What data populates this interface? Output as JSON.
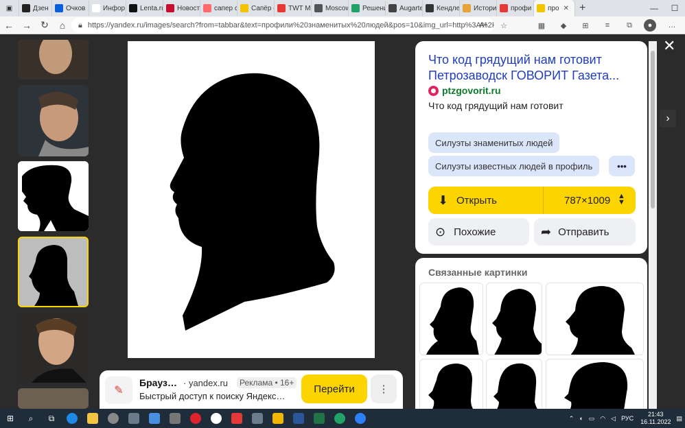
{
  "browser": {
    "tabs": [
      {
        "label": "Дзен",
        "color": "#222222"
      },
      {
        "label": "Очков",
        "color": "#0b5fd8"
      },
      {
        "label": "Инфор",
        "color": "#ffffff"
      },
      {
        "label": "Lenta.ru",
        "color": "#111111"
      },
      {
        "label": "Новост",
        "color": "#c8102e"
      },
      {
        "label": "сапер с",
        "color": "#ff6b6b"
      },
      {
        "label": "Сапёр с",
        "color": "#f2c500"
      },
      {
        "label": "TWT M",
        "color": "#e53935"
      },
      {
        "label": "Moscow",
        "color": "#555555"
      },
      {
        "label": "Решени",
        "color": "#21a366"
      },
      {
        "label": "Augarte",
        "color": "#444444"
      },
      {
        "label": "Кендле",
        "color": "#333333"
      },
      {
        "label": "Истори",
        "color": "#e8a33d"
      },
      {
        "label": "профи",
        "color": "#e53935"
      },
      {
        "label": "про",
        "color": "#f2c500",
        "active": true
      }
    ],
    "url": "https://yandex.ru/images/search?from=tabbar&text=профили%20знаменитых%20людей&pos=10&img_url=http%3A%2F%2F..."
  },
  "panel": {
    "title": "Что код грядущий нам готовит Петрозаводск ГОВОРИТ Газета...",
    "source": "ptzgovorit.ru",
    "description": "Что код грядущий нам готовит",
    "chips": [
      "Силуэты знаменитых людей",
      "Силуэты известных людей в профиль"
    ],
    "more": "•••",
    "open_label": "Открыть",
    "size_label": "787×1009",
    "similar_label": "Похожие",
    "share_label": "Отправить",
    "accent": "#fcd400"
  },
  "related": {
    "title": "Связанные картинки"
  },
  "ad": {
    "title": "Брауз…",
    "domain": "· yandex.ru",
    "badge": "Реклама • 16+",
    "text": "Быстрый доступ к поиску Яндекс…",
    "button": "Перейти"
  },
  "taskbar": {
    "lang": "РУС",
    "time": "21:43",
    "date": "16.11.2022"
  }
}
